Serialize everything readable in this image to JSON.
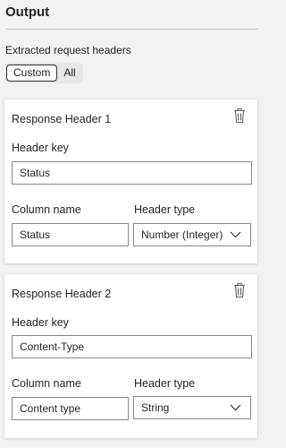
{
  "output": {
    "title": "Output",
    "section_label": "Extracted request headers",
    "toggle_options": [
      "Custom",
      "All"
    ],
    "selected_toggle": "Custom"
  },
  "headers": [
    {
      "title": "Response Header 1",
      "key_label": "Header key",
      "key_value": "Status",
      "column_label": "Column name",
      "column_value": "Status",
      "type_label": "Header type",
      "type_value": "Number (Integer)"
    },
    {
      "title": "Response Header 2",
      "key_label": "Header key",
      "key_value": "Content-Type",
      "column_label": "Column name",
      "column_value": "Content type",
      "type_label": "Header type",
      "type_value": "String"
    }
  ],
  "icons": {
    "delete": "trash-icon",
    "dropdown": "chevron-down-icon"
  }
}
